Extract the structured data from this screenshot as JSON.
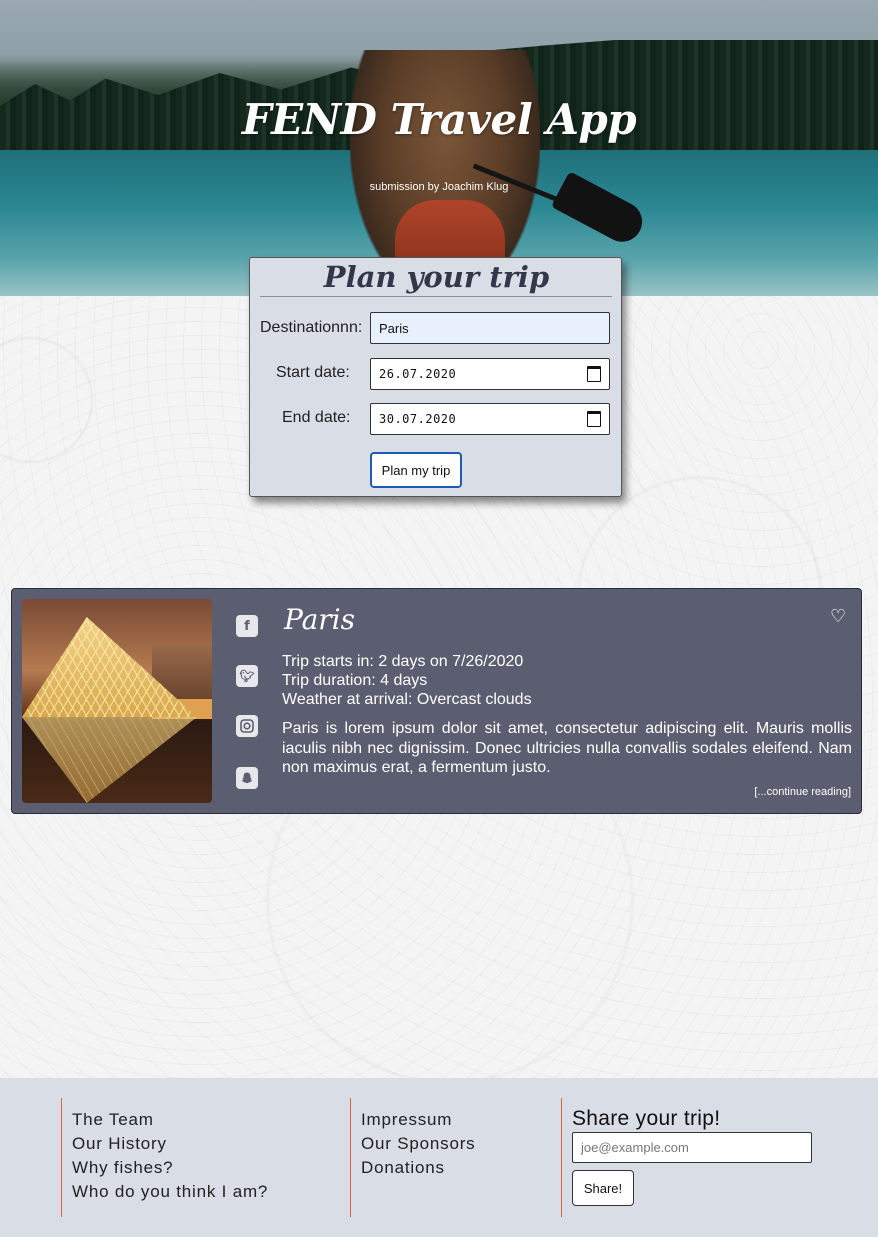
{
  "header": {
    "title": "FEND Travel App",
    "subtitle": "submission by Joachim Klug"
  },
  "plan_form": {
    "title": "Plan your trip",
    "destination_label": "Destinationnn:",
    "destination_value": "Paris",
    "start_label": "Start date:",
    "start_value": "26.07.2020",
    "end_label": "End date:",
    "end_value": "30.07.2020",
    "submit_label": "Plan my trip"
  },
  "trip": {
    "city": "Paris",
    "starts_in": "Trip starts in: 2 days on 7/26/2020",
    "duration": "Trip duration: 4 days",
    "weather": "Weather at arrival: Overcast clouds",
    "description": "Paris is lorem ipsum dolor sit amet, consectetur adipiscing elit. Mauris mollis iaculis nibh nec dignissim. Donec ultricies nulla convallis sodales eleifend. Nam non maximus erat, a fermentum justo.",
    "continue": "[...continue reading]",
    "social_icons": [
      "facebook-icon",
      "twitter-icon",
      "instagram-icon",
      "snapchat-icon"
    ],
    "favorite_icon": "heart-icon"
  },
  "footer": {
    "col1": [
      "The Team",
      "Our History",
      "Why fishes?",
      "Who do you think I am?"
    ],
    "col2": [
      "Impressum",
      "Our Sponsors",
      "Donations"
    ],
    "share_title": "Share your trip!",
    "share_placeholder": "joe@example.com",
    "share_button": "Share!"
  },
  "colors": {
    "card_bg": "#5b5e70",
    "form_bg": "#d9dde6",
    "footer_bg": "#d9dde6",
    "accent_border": "#e1653a",
    "button_focus": "#1e5bb8"
  }
}
